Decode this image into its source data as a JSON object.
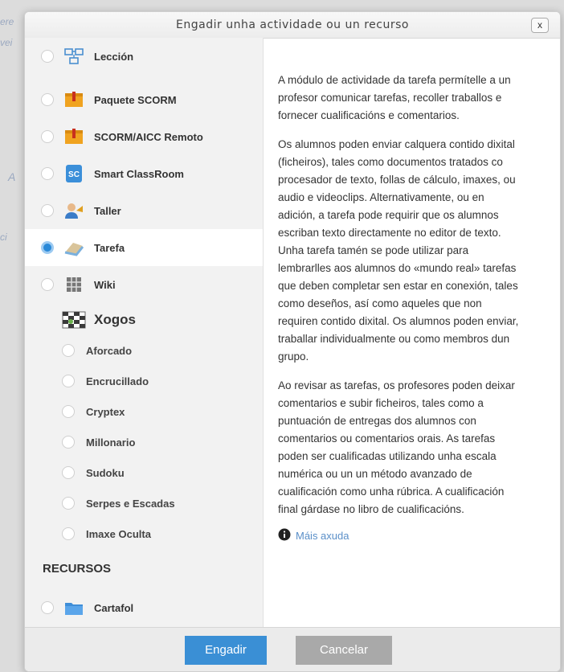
{
  "background": {
    "fragments": [
      "ere",
      "vei",
      "A",
      "ci"
    ]
  },
  "dialog": {
    "title": "Engadir unha actividade ou un recurso",
    "close_label": "x"
  },
  "activities": [
    {
      "label": "Lección",
      "icon": "lesson-icon",
      "selected": false
    },
    {
      "label": "Paquete SCORM",
      "icon": "scorm-package-icon",
      "selected": false
    },
    {
      "label": "SCORM/AICC Remoto",
      "icon": "scorm-remote-icon",
      "selected": false
    },
    {
      "label": "Smart ClassRoom",
      "icon": "smart-classroom-icon",
      "selected": false
    },
    {
      "label": "Taller",
      "icon": "workshop-icon",
      "selected": false
    },
    {
      "label": "Tarefa",
      "icon": "assignment-icon",
      "selected": true
    },
    {
      "label": "Wiki",
      "icon": "wiki-icon",
      "selected": false
    }
  ],
  "games_group": {
    "label": "Xogos",
    "icon": "games-icon",
    "items": [
      "Aforcado",
      "Encrucillado",
      "Cryptex",
      "Millonario",
      "Sudoku",
      "Serpes e Escadas",
      "Imaxe Oculta"
    ]
  },
  "resources": {
    "heading": "RECURSOS",
    "items": [
      {
        "label": "Cartafol",
        "icon": "folder-icon"
      }
    ]
  },
  "description": {
    "paragraphs": [
      "A módulo de actividade da tarefa permítelle a un profesor comunicar tarefas, recoller traballos e fornecer cualificacións e comentarios.",
      "Os alumnos poden enviar calquera contido dixital (ficheiros), tales como documentos tratados co procesador de texto, follas de cálculo, imaxes, ou audio e videoclips. Alternativamente, ou en adición, a tarefa pode requirir que os alumnos escriban texto directamente no editor de texto. Unha tarefa tamén se pode utilizar para lembrarlles aos alumnos do «mundo real» tarefas que deben completar sen estar en conexión, tales como deseños, así como aqueles que non requiren contido dixital. Os alumnos poden enviar, traballar individualmente ou como membros dun grupo.",
      "Ao revisar as tarefas, os profesores poden deixar comentarios e subir ficheiros, tales como a puntuación de entregas dos alumnos con comentarios ou comentarios orais. As tarefas poden ser cualificadas utilizando unha escala numérica ou un un método avanzado de cualificación como unha rúbrica. A cualificación final gárdase no libro de cualificacións."
    ],
    "help_link": "Máis axuda"
  },
  "footer": {
    "add_label": "Engadir",
    "cancel_label": "Cancelar"
  },
  "colors": {
    "accent": "#3a8fd5",
    "cancel": "#a9a9a9",
    "selected_radio": "#2a89d8"
  }
}
